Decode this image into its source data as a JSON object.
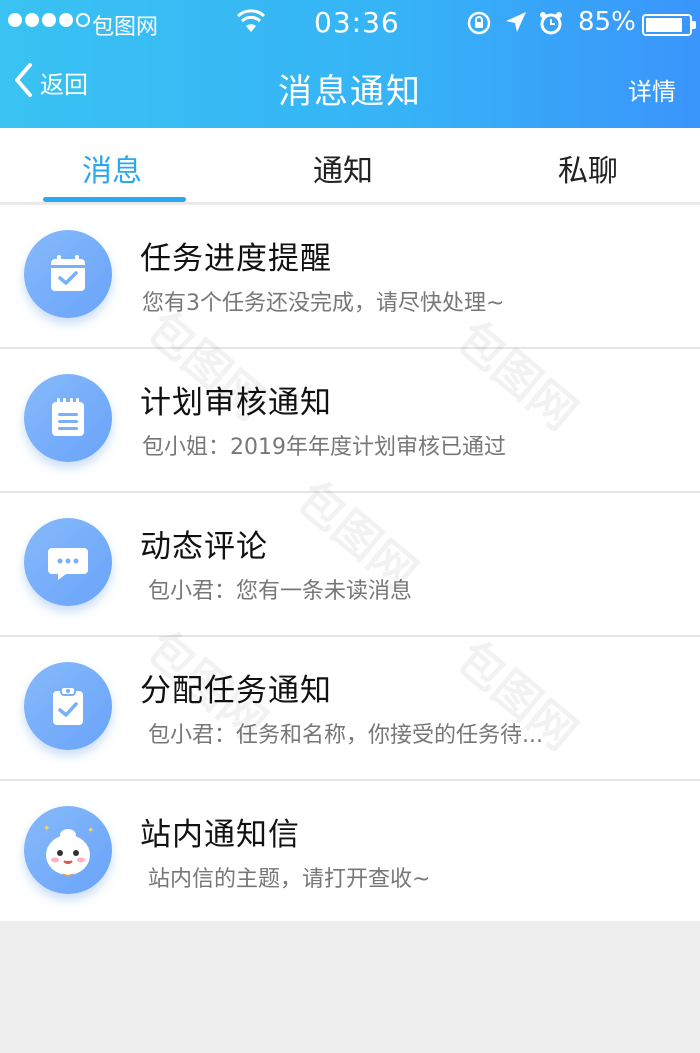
{
  "status_bar": {
    "carrier": "包图网",
    "time": "03:36",
    "battery": "85%",
    "battery_level": 0.85
  },
  "nav": {
    "back_label": "返回",
    "title": "消息通知",
    "detail_label": "详情"
  },
  "tabs": [
    {
      "label": "消息",
      "active": true
    },
    {
      "label": "通知",
      "active": false
    },
    {
      "label": "私聊",
      "active": false
    }
  ],
  "messages": [
    {
      "title": "任务进度提醒",
      "subtitle": "您有3个任务还没完成，请尽快处理~",
      "icon": "calendar-check-icon"
    },
    {
      "title": "计划审核通知",
      "subtitle": "包小姐：2019年年度计划审核已通过",
      "icon": "notepad-icon"
    },
    {
      "title": "动态评论",
      "subtitle": "包小君：您有一条未读消息",
      "icon": "chat-bubble-icon"
    },
    {
      "title": "分配任务通知",
      "subtitle": "包小君：任务和名称，你接受的任务待...",
      "icon": "clipboard-check-icon"
    },
    {
      "title": "站内通知信",
      "subtitle": "站内信的主题，请打开查收~",
      "icon": "mascot-avatar-icon"
    }
  ],
  "watermark": "包图网",
  "colors": {
    "header_start": "#39c2f2",
    "header_end": "#3a95fb",
    "accent": "#2aa8ef",
    "avatar": "#7aaffa"
  }
}
